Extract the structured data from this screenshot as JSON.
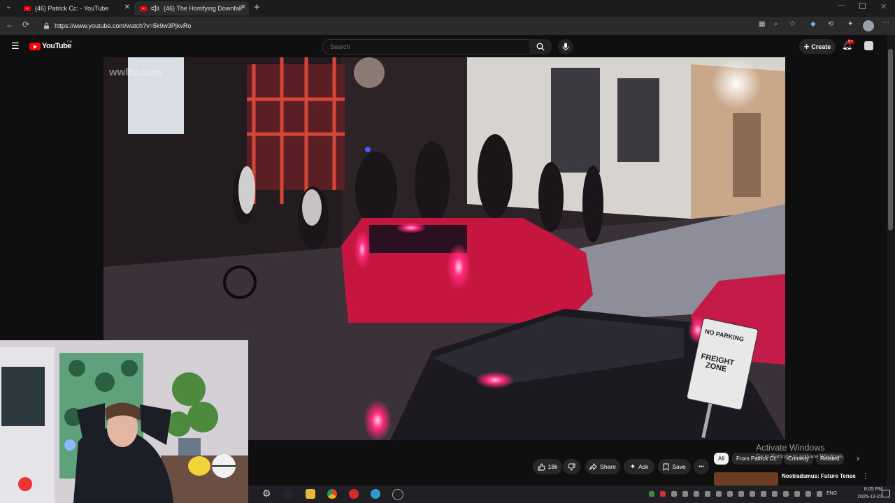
{
  "browser": {
    "tabs": [
      {
        "title": "(46) Patrick Cc: - YouTube",
        "active": false
      },
      {
        "title": "(46) The Horrifying Downfall",
        "active": true,
        "audio": true
      }
    ],
    "new_tab": "+",
    "url": "https://www.youtube.com/watch?v=5k9w3PjkvRo"
  },
  "youtube": {
    "logo": "YouTube",
    "region": "CA",
    "search_placeholder": "Search",
    "create_label": "Create",
    "notification_badge": "9+"
  },
  "video": {
    "watermark": "wwltv.com",
    "sign_top": "NO PARKING",
    "sign_mid": "FREIGHT ZONE"
  },
  "actions": {
    "likes": "18k",
    "share": "Share",
    "ask": "Ask",
    "save": "Save",
    "more": "•••"
  },
  "chips": {
    "items": [
      "All",
      "From Patrick Cc:",
      "Comedy",
      "Related"
    ]
  },
  "recommended": {
    "title": "Nostradamus: Future Tense",
    "menu": "⋮"
  },
  "watermark_os": {
    "title": "Activate Windows",
    "subtitle": "Go to Settings to activate Windows."
  },
  "taskbar": {
    "lang": "ENG",
    "time": "8:05 PM",
    "date": "2025-12-27"
  },
  "colors": {
    "yt_red": "#ff0000",
    "bg": "#0f0f0f"
  }
}
